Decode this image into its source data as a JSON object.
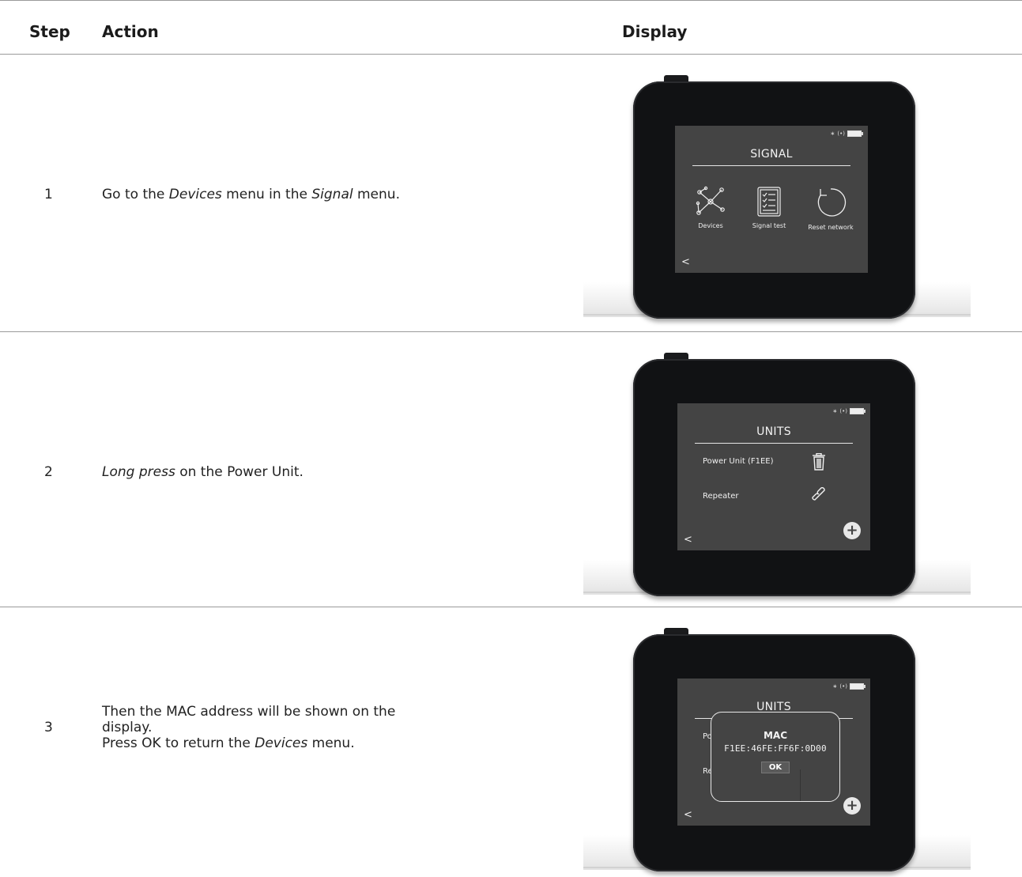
{
  "table": {
    "headers": {
      "step": "Step",
      "action": "Action",
      "display": "Display"
    },
    "rows": [
      {
        "step": "1",
        "action": {
          "p1": "Go to the ",
          "p2": "Devices",
          "p3": " menu in the ",
          "p4": "Signal",
          "p5": " menu."
        },
        "screen": {
          "title": "SIGNAL",
          "back": "<",
          "status": {
            "bt": "∗",
            "wifi": "(•)"
          },
          "tiles": [
            {
              "label": "Devices",
              "icon": "network-nodes-icon"
            },
            {
              "label": "Signal test",
              "icon": "checklist-icon"
            },
            {
              "label": "Reset network",
              "icon": "reset-arrow-icon"
            }
          ]
        }
      },
      {
        "step": "2",
        "action": {
          "p1": "Long press",
          "p2": " on the Power Unit."
        },
        "screen": {
          "title": "UNITS",
          "back": "<",
          "status": {
            "bt": "∗",
            "wifi": "(•)"
          },
          "units": [
            {
              "label": "Power Unit (F1EE)",
              "icon": "trash-icon"
            },
            {
              "label": "Repeater",
              "icon": "link-icon"
            }
          ],
          "plus": "+"
        }
      },
      {
        "step": "3",
        "action": {
          "l1": "Then the MAC address will be shown on the",
          "l2": "display.",
          "l3a": "Press OK to return the ",
          "l3b": "Devices",
          "l3c": " menu."
        },
        "screen": {
          "title": "UNITS",
          "back": "<",
          "status": {
            "bt": "∗",
            "wifi": "(•)"
          },
          "partial1": "Po",
          "partial2": "Re",
          "plus": "+",
          "modal": {
            "title": "MAC",
            "value": "F1EE:46FE:FF6F:0D00",
            "ok": "OK"
          }
        }
      }
    ]
  }
}
